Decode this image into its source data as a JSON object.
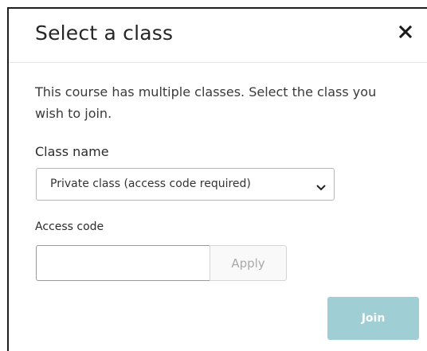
{
  "dialog": {
    "title": "Select a class",
    "close_icon": "close-icon",
    "intro_text": "This course has multiple classes. Select the class you wish to join.",
    "class_name_label": "Class name",
    "class_select": {
      "selected": "Private class (access code required)",
      "icon": "chevron-down-icon"
    },
    "access_code_label": "Access code",
    "access_code_input": {
      "value": "",
      "placeholder": ""
    },
    "apply_label": "Apply",
    "join_label": "Join"
  },
  "colors": {
    "join_button_bg": "#9fcfd5",
    "apply_button_text": "#a9a9a9",
    "border_dark": "#1f1f1f"
  }
}
